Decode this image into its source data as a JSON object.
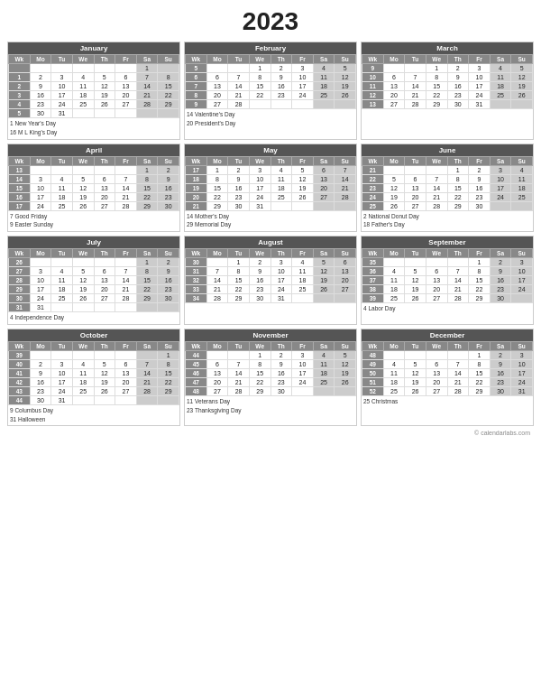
{
  "title": "2023",
  "months": [
    {
      "name": "January",
      "headers": [
        "Wk",
        "Mo",
        "Tu",
        "We",
        "Th",
        "Fr",
        "Sa",
        "Su"
      ],
      "rows": [
        [
          "",
          "",
          "",
          "",
          "",
          "",
          "1",
          ""
        ],
        [
          "1",
          "2",
          "3",
          "4",
          "5",
          "6",
          "7",
          "8"
        ],
        [
          "2",
          "9",
          "10",
          "11",
          "12",
          "13",
          "14",
          "15"
        ],
        [
          "3",
          "16",
          "17",
          "18",
          "19",
          "20",
          "21",
          "22"
        ],
        [
          "4",
          "23",
          "24",
          "25",
          "26",
          "27",
          "28",
          "29"
        ],
        [
          "5",
          "30",
          "31",
          "",
          "",
          "",
          "",
          ""
        ]
      ],
      "notes": [
        "1  New Year's Day",
        "16  M L King's Day"
      ]
    },
    {
      "name": "February",
      "headers": [
        "Wk",
        "Mo",
        "Tu",
        "We",
        "Th",
        "Fr",
        "Sa",
        "Su"
      ],
      "rows": [
        [
          "5",
          "",
          "",
          "1",
          "2",
          "3",
          "4",
          "5"
        ],
        [
          "6",
          "6",
          "7",
          "8",
          "9",
          "10",
          "11",
          "12"
        ],
        [
          "7",
          "13",
          "14",
          "15",
          "16",
          "17",
          "18",
          "19"
        ],
        [
          "8",
          "20",
          "21",
          "22",
          "23",
          "24",
          "25",
          "26"
        ],
        [
          "9",
          "27",
          "28",
          "",
          "",
          "",
          "",
          ""
        ]
      ],
      "notes": [
        "14  Valentine's Day",
        "20  President's Day"
      ]
    },
    {
      "name": "March",
      "headers": [
        "Wk",
        "Mo",
        "Tu",
        "We",
        "Th",
        "Fr",
        "Sa",
        "Su"
      ],
      "rows": [
        [
          "9",
          "",
          "",
          "1",
          "2",
          "3",
          "4",
          "5"
        ],
        [
          "10",
          "6",
          "7",
          "8",
          "9",
          "10",
          "11",
          "12"
        ],
        [
          "11",
          "13",
          "14",
          "15",
          "16",
          "17",
          "18",
          "19"
        ],
        [
          "12",
          "20",
          "21",
          "22",
          "23",
          "24",
          "25",
          "26"
        ],
        [
          "13",
          "27",
          "28",
          "29",
          "30",
          "31",
          "",
          ""
        ]
      ],
      "notes": []
    },
    {
      "name": "April",
      "headers": [
        "Wk",
        "Mo",
        "Tu",
        "We",
        "Th",
        "Fr",
        "Sa",
        "Su"
      ],
      "rows": [
        [
          "13",
          "",
          "",
          "",
          "",
          "",
          "1",
          "2"
        ],
        [
          "14",
          "3",
          "4",
          "5",
          "6",
          "7",
          "8",
          "9"
        ],
        [
          "15",
          "10",
          "11",
          "12",
          "13",
          "14",
          "15",
          "16"
        ],
        [
          "16",
          "17",
          "18",
          "19",
          "20",
          "21",
          "22",
          "23"
        ],
        [
          "17",
          "24",
          "25",
          "26",
          "27",
          "28",
          "29",
          "30"
        ]
      ],
      "notes": [
        "7  Good Friday",
        "9  Easter Sunday"
      ]
    },
    {
      "name": "May",
      "headers": [
        "Wk",
        "Mo",
        "Tu",
        "We",
        "Th",
        "Fr",
        "Sa",
        "Su"
      ],
      "rows": [
        [
          "17",
          "1",
          "2",
          "3",
          "4",
          "5",
          "6",
          "7"
        ],
        [
          "18",
          "8",
          "9",
          "10",
          "11",
          "12",
          "13",
          "14"
        ],
        [
          "19",
          "15",
          "16",
          "17",
          "18",
          "19",
          "20",
          "21"
        ],
        [
          "20",
          "22",
          "23",
          "24",
          "25",
          "26",
          "27",
          "28"
        ],
        [
          "21",
          "29",
          "30",
          "31",
          "",
          "",
          "",
          ""
        ]
      ],
      "notes": [
        "14  Mother's Day",
        "29  Memorial Day"
      ]
    },
    {
      "name": "June",
      "headers": [
        "Wk",
        "Mo",
        "Tu",
        "We",
        "Th",
        "Fr",
        "Sa",
        "Su"
      ],
      "rows": [
        [
          "21",
          "",
          "",
          "",
          "1",
          "2",
          "3",
          "4"
        ],
        [
          "22",
          "5",
          "6",
          "7",
          "8",
          "9",
          "10",
          "11"
        ],
        [
          "23",
          "12",
          "13",
          "14",
          "15",
          "16",
          "17",
          "18"
        ],
        [
          "24",
          "19",
          "20",
          "21",
          "22",
          "23",
          "24",
          "25"
        ],
        [
          "25",
          "26",
          "27",
          "28",
          "29",
          "30",
          "",
          ""
        ]
      ],
      "notes": [
        "2  National Donut Day",
        "18  Father's Day"
      ]
    },
    {
      "name": "July",
      "headers": [
        "Wk",
        "Mo",
        "Tu",
        "We",
        "Th",
        "Fr",
        "Sa",
        "Su"
      ],
      "rows": [
        [
          "26",
          "",
          "",
          "",
          "",
          "",
          "1",
          "2"
        ],
        [
          "27",
          "3",
          "4",
          "5",
          "6",
          "7",
          "8",
          "9"
        ],
        [
          "28",
          "10",
          "11",
          "12",
          "13",
          "14",
          "15",
          "16"
        ],
        [
          "29",
          "17",
          "18",
          "19",
          "20",
          "21",
          "22",
          "23"
        ],
        [
          "30",
          "24",
          "25",
          "26",
          "27",
          "28",
          "29",
          "30"
        ],
        [
          "31",
          "31",
          "",
          "",
          "",
          "",
          "",
          ""
        ]
      ],
      "notes": [
        "4  Independence Day"
      ]
    },
    {
      "name": "August",
      "headers": [
        "Wk",
        "Mo",
        "Tu",
        "We",
        "Th",
        "Fr",
        "Sa",
        "Su"
      ],
      "rows": [
        [
          "30",
          "",
          "1",
          "2",
          "3",
          "4",
          "5",
          "6"
        ],
        [
          "31",
          "7",
          "8",
          "9",
          "10",
          "11",
          "12",
          "13"
        ],
        [
          "32",
          "14",
          "15",
          "16",
          "17",
          "18",
          "19",
          "20"
        ],
        [
          "33",
          "21",
          "22",
          "23",
          "24",
          "25",
          "26",
          "27"
        ],
        [
          "34",
          "28",
          "29",
          "30",
          "31",
          "",
          "",
          ""
        ]
      ],
      "notes": []
    },
    {
      "name": "September",
      "headers": [
        "Wk",
        "Mo",
        "Tu",
        "We",
        "Th",
        "Fr",
        "Sa",
        "Su"
      ],
      "rows": [
        [
          "35",
          "",
          "",
          "",
          "",
          "1",
          "2",
          "3"
        ],
        [
          "36",
          "4",
          "5",
          "6",
          "7",
          "8",
          "9",
          "10"
        ],
        [
          "37",
          "11",
          "12",
          "13",
          "14",
          "15",
          "16",
          "17"
        ],
        [
          "38",
          "18",
          "19",
          "20",
          "21",
          "22",
          "23",
          "24"
        ],
        [
          "39",
          "25",
          "26",
          "27",
          "28",
          "29",
          "30",
          ""
        ]
      ],
      "notes": [
        "4  Labor Day"
      ]
    },
    {
      "name": "October",
      "headers": [
        "Wk",
        "Mo",
        "Tu",
        "We",
        "Th",
        "Fr",
        "Sa",
        "Su"
      ],
      "rows": [
        [
          "39",
          "",
          "",
          "",
          "",
          "",
          "",
          "1"
        ],
        [
          "40",
          "2",
          "3",
          "4",
          "5",
          "6",
          "7",
          "8"
        ],
        [
          "41",
          "9",
          "10",
          "11",
          "12",
          "13",
          "14",
          "15"
        ],
        [
          "42",
          "16",
          "17",
          "18",
          "19",
          "20",
          "21",
          "22"
        ],
        [
          "43",
          "23",
          "24",
          "25",
          "26",
          "27",
          "28",
          "29"
        ],
        [
          "44",
          "30",
          "31",
          "",
          "",
          "",
          "",
          ""
        ]
      ],
      "notes": [
        "9  Columbus Day",
        "31  Halloween"
      ]
    },
    {
      "name": "November",
      "headers": [
        "Wk",
        "Mo",
        "Tu",
        "We",
        "Th",
        "Fr",
        "Sa",
        "Su"
      ],
      "rows": [
        [
          "44",
          "",
          "",
          "1",
          "2",
          "3",
          "4",
          "5"
        ],
        [
          "45",
          "6",
          "7",
          "8",
          "9",
          "10",
          "11",
          "12"
        ],
        [
          "46",
          "13",
          "14",
          "15",
          "16",
          "17",
          "18",
          "19"
        ],
        [
          "47",
          "20",
          "21",
          "22",
          "23",
          "24",
          "25",
          "26"
        ],
        [
          "48",
          "27",
          "28",
          "29",
          "30",
          "",
          "",
          ""
        ]
      ],
      "notes": [
        "11  Veterans Day",
        "23  Thanksgiving Day"
      ]
    },
    {
      "name": "December",
      "headers": [
        "Wk",
        "Mo",
        "Tu",
        "We",
        "Th",
        "Fr",
        "Sa",
        "Su"
      ],
      "rows": [
        [
          "48",
          "",
          "",
          "",
          "",
          "1",
          "2",
          "3"
        ],
        [
          "49",
          "4",
          "5",
          "6",
          "7",
          "8",
          "9",
          "10"
        ],
        [
          "50",
          "11",
          "12",
          "13",
          "14",
          "15",
          "16",
          "17"
        ],
        [
          "51",
          "18",
          "19",
          "20",
          "21",
          "22",
          "23",
          "24"
        ],
        [
          "52",
          "25",
          "26",
          "27",
          "28",
          "29",
          "30",
          "31"
        ]
      ],
      "notes": [
        "25  Christmas"
      ]
    }
  ],
  "footer": "© calendarlabs.com"
}
